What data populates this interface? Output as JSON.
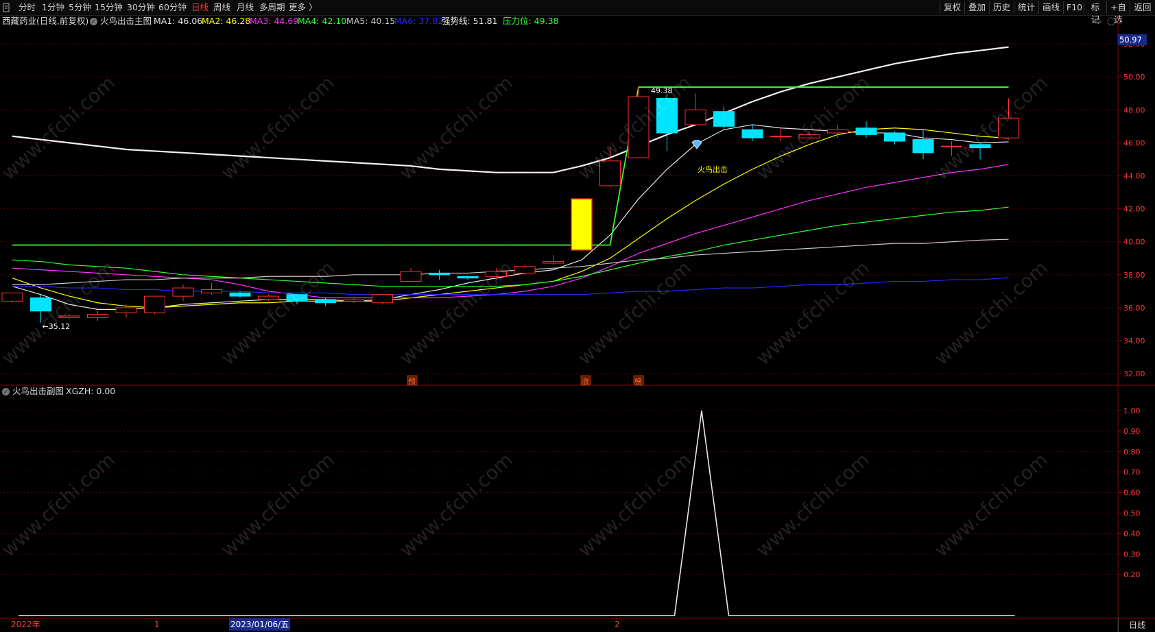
{
  "toolbar": {
    "menu_icon": "menu-icon",
    "periods": [
      "分时",
      "1分钟",
      "5分钟",
      "15分钟",
      "30分钟",
      "60分钟",
      "日线",
      "周线",
      "月线",
      "多周期",
      "更多 〉"
    ],
    "active_period": "日线",
    "right_buttons": [
      "复权",
      "叠加",
      "历史",
      "统计",
      "画线",
      "F10",
      "标记",
      "+自选",
      "返回"
    ]
  },
  "main_legend": {
    "stock": "西藏药业(日线,前复权)",
    "indicator": "火鸟出击主图",
    "items": [
      {
        "label": "MA1: 46.06",
        "color": "#e8e8e8"
      },
      {
        "label": "MA2: 46.28",
        "color": "#ffff00"
      },
      {
        "label": "MA3: 44.69",
        "color": "#ff33ff"
      },
      {
        "label": "MA4: 42.10",
        "color": "#33ff33"
      },
      {
        "label": "MA5: 40.15",
        "color": "#c8c8c8"
      },
      {
        "label": "MA6: 37.82",
        "color": "#2828ff"
      },
      {
        "label": "强势线: 51.81",
        "color": "#e8e8e8"
      },
      {
        "label": "压力位: 49.38",
        "color": "#33ff33"
      }
    ]
  },
  "sub_legend": {
    "indicator": "火鸟出击副图",
    "value": "XGZH: 0.00"
  },
  "main_axis": {
    "ticks": [
      "52.00",
      "50.00",
      "48.00",
      "46.00",
      "44.00",
      "42.00",
      "40.00",
      "38.00",
      "36.00",
      "34.00",
      "32.00"
    ],
    "current_price": "50.97"
  },
  "sub_axis": {
    "ticks": [
      "1.00",
      "0.90",
      "0.80",
      "0.70",
      "0.60",
      "0.50",
      "0.40",
      "0.30",
      "0.20"
    ]
  },
  "annotations": {
    "high_label": "49.38",
    "low_label": "←35.12",
    "signal_text": "火鸟出击",
    "markers": [
      "预",
      "涨",
      "榜"
    ]
  },
  "dates": {
    "year": "2022年",
    "m1": "1",
    "cursor_date": "2023/01/06/五",
    "m2": "2"
  },
  "bottom_tab": "日线",
  "watermark": "www.cfchi.com",
  "chart_data": {
    "type": "candlestick",
    "ylim": [
      31.3,
      53.0
    ],
    "candles": [
      {
        "o": 36.4,
        "c": 36.9,
        "h": 36.9,
        "l": 36.3
      },
      {
        "o": 36.6,
        "c": 35.8,
        "h": 36.8,
        "l": 35.1
      },
      {
        "o": 35.4,
        "c": 35.5,
        "h": 35.6,
        "l": 35.3
      },
      {
        "o": 35.4,
        "c": 35.6,
        "h": 35.8,
        "l": 35.2
      },
      {
        "o": 35.7,
        "c": 36.0,
        "h": 36.2,
        "l": 35.4
      },
      {
        "o": 35.7,
        "c": 36.7,
        "h": 36.7,
        "l": 35.6
      },
      {
        "o": 36.7,
        "c": 37.2,
        "h": 37.4,
        "l": 36.4
      },
      {
        "o": 36.9,
        "c": 37.1,
        "h": 37.5,
        "l": 36.8
      },
      {
        "o": 36.9,
        "c": 36.7,
        "h": 37.0,
        "l": 36.6
      },
      {
        "o": 36.5,
        "c": 36.7,
        "h": 36.8,
        "l": 36.4
      },
      {
        "o": 36.8,
        "c": 36.4,
        "h": 36.8,
        "l": 36.2
      },
      {
        "o": 36.5,
        "c": 36.3,
        "h": 36.6,
        "l": 36.1
      },
      {
        "o": 36.4,
        "c": 36.5,
        "h": 36.6,
        "l": 36.3
      },
      {
        "o": 36.3,
        "c": 36.8,
        "h": 36.8,
        "l": 36.2
      },
      {
        "o": 37.6,
        "c": 38.2,
        "h": 38.4,
        "l": 37.6
      },
      {
        "o": 38.1,
        "c": 38.0,
        "h": 38.3,
        "l": 37.7
      },
      {
        "o": 37.9,
        "c": 37.8,
        "h": 37.9,
        "l": 37.7
      },
      {
        "o": 37.9,
        "c": 38.2,
        "h": 38.4,
        "l": 37.7
      },
      {
        "o": 38.1,
        "c": 38.5,
        "h": 38.6,
        "l": 38.0
      },
      {
        "o": 38.7,
        "c": 38.8,
        "h": 39.2,
        "l": 38.6
      },
      {
        "o": 39.5,
        "c": 42.6,
        "h": 42.6,
        "l": 39.4
      },
      {
        "o": 43.4,
        "c": 44.9,
        "h": 45.8,
        "l": 43.3
      },
      {
        "o": 45.1,
        "c": 48.8,
        "h": 49.4,
        "l": 45.1
      },
      {
        "o": 48.7,
        "c": 46.6,
        "h": 48.9,
        "l": 45.5
      },
      {
        "o": 47.1,
        "c": 48.0,
        "h": 49.0,
        "l": 47.0
      },
      {
        "o": 47.9,
        "c": 47.0,
        "h": 48.2,
        "l": 46.8
      },
      {
        "o": 46.8,
        "c": 46.3,
        "h": 47.1,
        "l": 46.1
      },
      {
        "o": 46.4,
        "c": 46.4,
        "h": 46.9,
        "l": 46.1
      },
      {
        "o": 46.3,
        "c": 46.5,
        "h": 46.7,
        "l": 46.2
      },
      {
        "o": 46.6,
        "c": 46.8,
        "h": 47.1,
        "l": 46.3
      },
      {
        "o": 46.9,
        "c": 46.5,
        "h": 47.3,
        "l": 46.3
      },
      {
        "o": 46.6,
        "c": 46.1,
        "h": 46.7,
        "l": 45.9
      },
      {
        "o": 46.2,
        "c": 45.4,
        "h": 46.8,
        "l": 45.0
      },
      {
        "o": 45.8,
        "c": 45.8,
        "h": 46.1,
        "l": 45.2
      },
      {
        "o": 45.9,
        "c": 45.7,
        "h": 46.0,
        "l": 45.0
      },
      {
        "o": 46.3,
        "c": 47.5,
        "h": 48.7,
        "l": 46.2
      }
    ],
    "lines": [
      {
        "name": "MA1",
        "color": "#e8e8e8",
        "values": [
          37.3,
          36.8,
          36.2,
          35.9,
          35.9,
          36.0,
          36.2,
          36.3,
          36.4,
          36.5,
          36.5,
          36.5,
          36.4,
          36.5,
          36.8,
          37.1,
          37.5,
          37.8,
          38.1,
          38.3,
          38.9,
          40.4,
          42.6,
          44.4,
          45.9,
          46.8,
          47.1,
          46.9,
          46.8,
          46.7,
          46.6,
          46.6,
          46.3,
          46.2,
          46.0,
          46.06
        ]
      },
      {
        "name": "MA2",
        "color": "#ffff00",
        "values": [
          37.8,
          37.2,
          36.7,
          36.3,
          36.1,
          36.0,
          36.1,
          36.2,
          36.3,
          36.3,
          36.4,
          36.4,
          36.4,
          36.4,
          36.6,
          36.8,
          37.0,
          37.2,
          37.4,
          37.6,
          38.2,
          39.0,
          40.2,
          41.4,
          42.5,
          43.5,
          44.4,
          45.2,
          45.9,
          46.5,
          46.8,
          46.9,
          46.8,
          46.6,
          46.4,
          46.28
        ]
      },
      {
        "name": "MA3",
        "color": "#ff33ff",
        "values": [
          38.4,
          38.3,
          38.2,
          38.1,
          38.0,
          37.9,
          37.8,
          37.7,
          37.4,
          37.0,
          36.8,
          36.6,
          36.6,
          36.6,
          36.6,
          36.6,
          36.7,
          36.8,
          37.0,
          37.3,
          37.8,
          38.5,
          39.3,
          39.9,
          40.5,
          41.0,
          41.5,
          42.0,
          42.5,
          42.9,
          43.3,
          43.6,
          43.9,
          44.2,
          44.4,
          44.69
        ]
      },
      {
        "name": "MA4",
        "color": "#33ff33",
        "values": [
          38.9,
          38.8,
          38.6,
          38.5,
          38.4,
          38.2,
          38.0,
          37.9,
          37.8,
          37.7,
          37.6,
          37.5,
          37.4,
          37.3,
          37.3,
          37.3,
          37.3,
          37.3,
          37.4,
          37.6,
          37.9,
          38.3,
          38.7,
          39.1,
          39.4,
          39.8,
          40.1,
          40.4,
          40.7,
          41.0,
          41.2,
          41.4,
          41.6,
          41.8,
          41.9,
          42.1
        ]
      },
      {
        "name": "MA5",
        "color": "#c8c8c8",
        "values": [
          37.4,
          37.4,
          37.5,
          37.6,
          37.7,
          37.7,
          37.8,
          37.8,
          37.8,
          37.9,
          37.9,
          37.9,
          38.0,
          38.0,
          38.0,
          38.1,
          38.1,
          38.2,
          38.3,
          38.4,
          38.5,
          38.7,
          38.9,
          39.0,
          39.2,
          39.3,
          39.4,
          39.5,
          39.6,
          39.7,
          39.8,
          39.9,
          39.9,
          40.0,
          40.1,
          40.15
        ]
      },
      {
        "name": "MA6",
        "color": "#2828ff",
        "values": [
          37.3,
          37.3,
          37.2,
          37.2,
          37.1,
          37.1,
          37.0,
          37.0,
          37.0,
          36.9,
          36.9,
          36.9,
          36.8,
          36.8,
          36.8,
          36.8,
          36.8,
          36.8,
          36.8,
          36.8,
          36.8,
          36.9,
          37.0,
          37.0,
          37.1,
          37.2,
          37.2,
          37.3,
          37.4,
          37.4,
          37.5,
          37.6,
          37.6,
          37.7,
          37.7,
          37.82
        ]
      },
      {
        "name": "强势线",
        "color": "#f0f0f0",
        "values": [
          46.4,
          46.2,
          46.0,
          45.8,
          45.6,
          45.5,
          45.4,
          45.3,
          45.2,
          45.1,
          45.0,
          44.9,
          44.8,
          44.7,
          44.6,
          44.4,
          44.3,
          44.2,
          44.2,
          44.2,
          44.6,
          45.1,
          45.8,
          46.5,
          47.1,
          47.8,
          48.5,
          49.1,
          49.6,
          50.0,
          50.4,
          50.8,
          51.1,
          51.4,
          51.6,
          51.81
        ]
      }
    ],
    "pressure_line": [
      {
        "i": 0,
        "v": 39.8
      },
      {
        "i": 20,
        "v": 39.8
      },
      {
        "i": 21,
        "v": 39.8
      },
      {
        "i": 22,
        "v": 49.38
      },
      {
        "i": 35,
        "v": 49.38
      }
    ],
    "sub": {
      "ylim": [
        0.0,
        1.05
      ],
      "values": [
        0,
        0,
        0,
        0,
        0,
        0,
        0,
        0,
        0,
        0,
        0,
        0,
        0,
        0,
        0,
        0,
        0,
        0,
        0,
        0,
        0,
        0,
        0,
        0,
        1,
        0,
        0,
        0,
        0,
        0,
        0,
        0,
        0,
        0,
        0,
        0
      ]
    }
  }
}
